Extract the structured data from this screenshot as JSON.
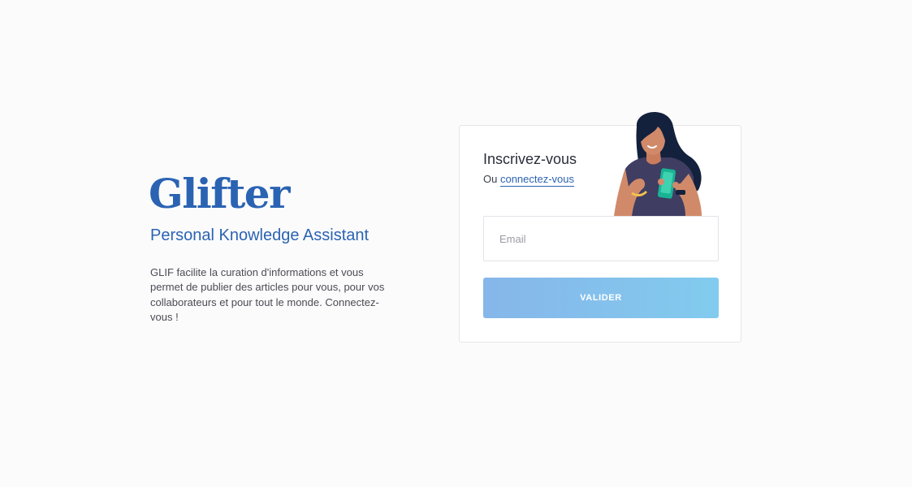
{
  "brand": {
    "logo_text": "Glifter",
    "tagline": "Personal Knowledge Assistant",
    "description": "GLIF facilite la curation d'informations et vous permet de publier des articles pour vous, pour vos collaborateurs et pour tout le monde. Connectez-vous !"
  },
  "signup": {
    "title": "Inscrivez-vous",
    "alt_prefix": "Ou",
    "login_link": "connectez-vous",
    "email_placeholder": "Email",
    "email_value": "",
    "submit_label": "VALIDER"
  },
  "illustration": {
    "icon": "woman-with-phone-illustration"
  },
  "colors": {
    "brand_blue": "#2b63b3",
    "button_gradient_start": "#86b6ea",
    "button_gradient_end": "#82cbee",
    "page_background": "#fbfbfb",
    "card_background": "#ffffff"
  }
}
